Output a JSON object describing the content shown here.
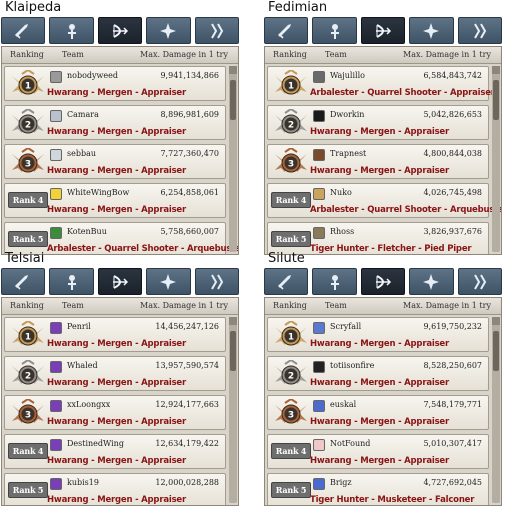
{
  "headers": {
    "ranking": "Ranking",
    "team": "Team",
    "damage": "Max. Damage in 1 try"
  },
  "medals": {
    "gold": "#c49a5a",
    "silver": "#8f8f8f",
    "bronze": "#a8623a"
  },
  "class_text_color": "#8a1414",
  "servers": [
    {
      "name": "Klaipeda",
      "active_tab": 2,
      "tabs": [
        "sword-icon",
        "cleric-icon",
        "archer-bow-icon",
        "wizard-icon",
        "scout-icon"
      ],
      "rows": [
        {
          "rank": "1",
          "medal": "gold",
          "team": "nobodyweed",
          "avatar_color": "#9a9a9a",
          "damage": "9,941,134,866",
          "classes": "Hwarang - Mergen - Appraiser"
        },
        {
          "rank": "2",
          "medal": "silver",
          "team": "Camara",
          "avatar_color": "#b9c2cc",
          "damage": "8,896,981,609",
          "classes": "Hwarang - Mergen - Appraiser"
        },
        {
          "rank": "3",
          "medal": "bronze",
          "team": "sebbau",
          "avatar_color": "#cfd6dc",
          "damage": "7,727,360,470",
          "classes": "Hwarang - Mergen - Appraiser"
        },
        {
          "rank": "Rank 4",
          "medal": "plain",
          "team": "WhiteWingBow",
          "avatar_color": "#f1d23a",
          "damage": "6,254,858,061",
          "classes": "Hwarang - Mergen - Appraiser"
        },
        {
          "rank": "Rank 5",
          "medal": "plain",
          "team": "KotenBuu",
          "avatar_color": "#3c8c3c",
          "damage": "5,758,660,007",
          "classes": "Arbalester - Quarrel Shooter - Arquebusier"
        }
      ]
    },
    {
      "name": "Fedimian",
      "active_tab": 2,
      "tabs": [
        "sword-icon",
        "cleric-icon",
        "archer-bow-icon",
        "wizard-icon",
        "scout-icon"
      ],
      "rows": [
        {
          "rank": "1",
          "medal": "gold",
          "team": "Wajulillo",
          "avatar_color": "#6a6a6a",
          "damage": "6,584,843,742",
          "classes": "Arbalester - Quarrel Shooter - Appraiser"
        },
        {
          "rank": "2",
          "medal": "silver",
          "team": "Dworkin",
          "avatar_color": "#1a1a1a",
          "damage": "5,042,826,653",
          "classes": "Hwarang - Mergen - Appraiser"
        },
        {
          "rank": "3",
          "medal": "bronze",
          "team": "Trapnest",
          "avatar_color": "#7a4a2a",
          "damage": "4,800,844,038",
          "classes": "Hwarang - Mergen - Appraiser"
        },
        {
          "rank": "Rank 4",
          "medal": "plain",
          "team": "Nuko",
          "avatar_color": "#c9a45a",
          "damage": "4,026,745,498",
          "classes": "Arbalester - Quarrel Shooter - Arquebusier"
        },
        {
          "rank": "Rank 5",
          "medal": "plain",
          "team": "Rhoss",
          "avatar_color": "#8a7a5a",
          "damage": "3,826,937,676",
          "classes": "Tiger Hunter - Fletcher - Pied Piper"
        }
      ]
    },
    {
      "name": "Telsiai",
      "active_tab": 2,
      "tabs": [
        "sword-icon",
        "cleric-icon",
        "archer-bow-icon",
        "wizard-icon",
        "scout-icon"
      ],
      "rows": [
        {
          "rank": "1",
          "medal": "gold",
          "team": "Penril",
          "avatar_color": "#7a3fb8",
          "damage": "14,456,247,126",
          "classes": "Hwarang - Mergen - Appraiser"
        },
        {
          "rank": "2",
          "medal": "silver",
          "team": "Whaled",
          "avatar_color": "#7a3fb8",
          "damage": "13,957,590,574",
          "classes": "Hwarang - Mergen - Appraiser"
        },
        {
          "rank": "3",
          "medal": "bronze",
          "team": "xxLoongxx",
          "avatar_color": "#7a3fb8",
          "damage": "12,924,177,663",
          "classes": "Hwarang - Mergen - Appraiser"
        },
        {
          "rank": "Rank 4",
          "medal": "plain",
          "team": "DestinedWing",
          "avatar_color": "#7a3fb8",
          "damage": "12,634,179,422",
          "classes": "Hwarang - Mergen - Appraiser"
        },
        {
          "rank": "Rank 5",
          "medal": "plain",
          "team": "kubis19",
          "avatar_color": "#7a3fb8",
          "damage": "12,000,028,288",
          "classes": "Hwarang - Mergen - Appraiser"
        }
      ]
    },
    {
      "name": "Silute",
      "active_tab": 2,
      "tabs": [
        "sword-icon",
        "cleric-icon",
        "archer-bow-icon",
        "wizard-icon",
        "scout-icon"
      ],
      "rows": [
        {
          "rank": "1",
          "medal": "gold",
          "team": "Scryfall",
          "avatar_color": "#5a7ad0",
          "damage": "9,619,750,232",
          "classes": "Hwarang - Mergen - Appraiser"
        },
        {
          "rank": "2",
          "medal": "silver",
          "team": "totiisonfire",
          "avatar_color": "#222222",
          "damage": "8,528,250,607",
          "classes": "Hwarang - Mergen - Appraiser"
        },
        {
          "rank": "3",
          "medal": "bronze",
          "team": "euskal",
          "avatar_color": "#4a6ad0",
          "damage": "7,548,179,771",
          "classes": "Hwarang - Mergen - Appraiser"
        },
        {
          "rank": "Rank 4",
          "medal": "plain",
          "team": "NotFound",
          "avatar_color": "#f0c8c8",
          "damage": "5,010,307,417",
          "classes": "Hwarang - Mergen - Appraiser"
        },
        {
          "rank": "Rank 5",
          "medal": "plain",
          "team": "Brigz",
          "avatar_color": "#4a6ad0",
          "damage": "4,727,692,045",
          "classes": "Tiger Hunter - Musketeer - Falconer"
        }
      ]
    }
  ]
}
